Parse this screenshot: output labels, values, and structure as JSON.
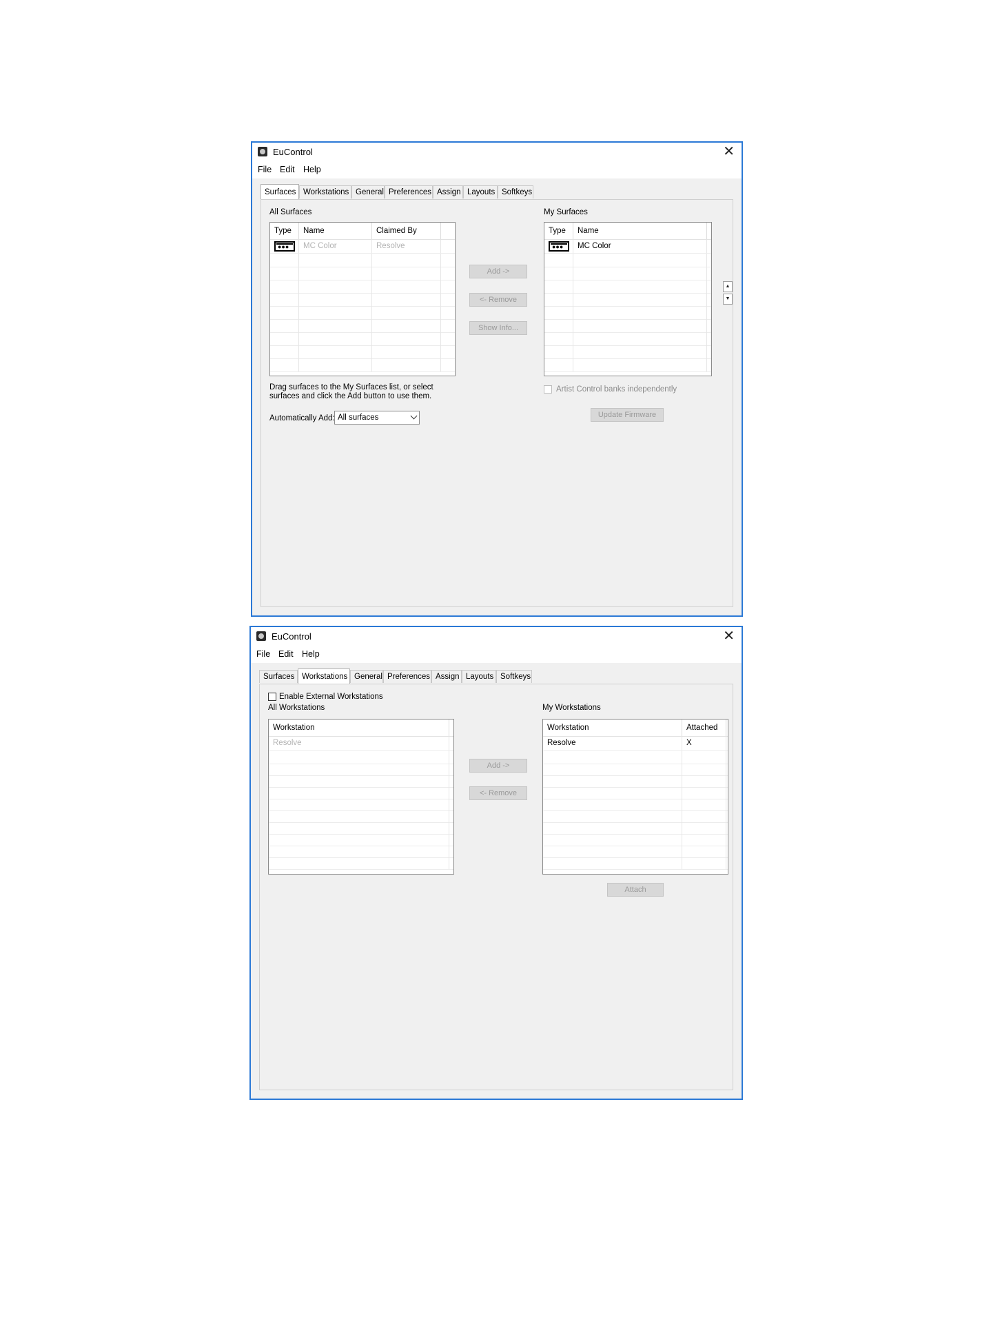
{
  "app": {
    "title": "EuControl"
  },
  "menu": {
    "file": "File",
    "edit": "Edit",
    "help": "Help"
  },
  "tabs": [
    "Surfaces",
    "Workstations",
    "General",
    "Preferences",
    "Assign",
    "Layouts",
    "Softkeys"
  ],
  "surfaces_window": {
    "active_tab": "Surfaces",
    "all_surfaces": {
      "label": "All Surfaces",
      "columns": [
        "Type",
        "Name",
        "Claimed By"
      ],
      "rows": [
        {
          "icon": "surface-icon",
          "name": "MC Color",
          "claimed_by": "Resolve"
        }
      ]
    },
    "buttons": {
      "add": "Add ->",
      "remove": "<- Remove",
      "show_info": "Show Info...",
      "update_firmware": "Update Firmware"
    },
    "my_surfaces": {
      "label": "My Surfaces",
      "columns": [
        "Type",
        "Name"
      ],
      "rows": [
        {
          "icon": "surface-icon",
          "name": "MC Color"
        }
      ]
    },
    "help_text_line1": "Drag surfaces to the My Surfaces list, or select",
    "help_text_line2": "surfaces and click the Add button to use them.",
    "auto_add_label": "Automatically Add:",
    "auto_add_value": "All surfaces",
    "artist_control_checkbox": "Artist Control banks independently"
  },
  "workstations_window": {
    "active_tab": "Workstations",
    "enable_external": "Enable External Workstations",
    "all_workstations": {
      "label": "All Workstations",
      "columns": [
        "Workstation"
      ],
      "rows": [
        {
          "name": "Resolve"
        }
      ]
    },
    "buttons": {
      "add": "Add ->",
      "remove": "<- Remove",
      "attach": "Attach"
    },
    "my_workstations": {
      "label": "My Workstations",
      "columns": [
        "Workstation",
        "Attached"
      ],
      "rows": [
        {
          "name": "Resolve",
          "attached": "X"
        }
      ]
    }
  },
  "colors": {
    "window_border": "#2b79d6",
    "panel_bg": "#f0f0f0",
    "disabled_text": "#b3b3b3"
  }
}
